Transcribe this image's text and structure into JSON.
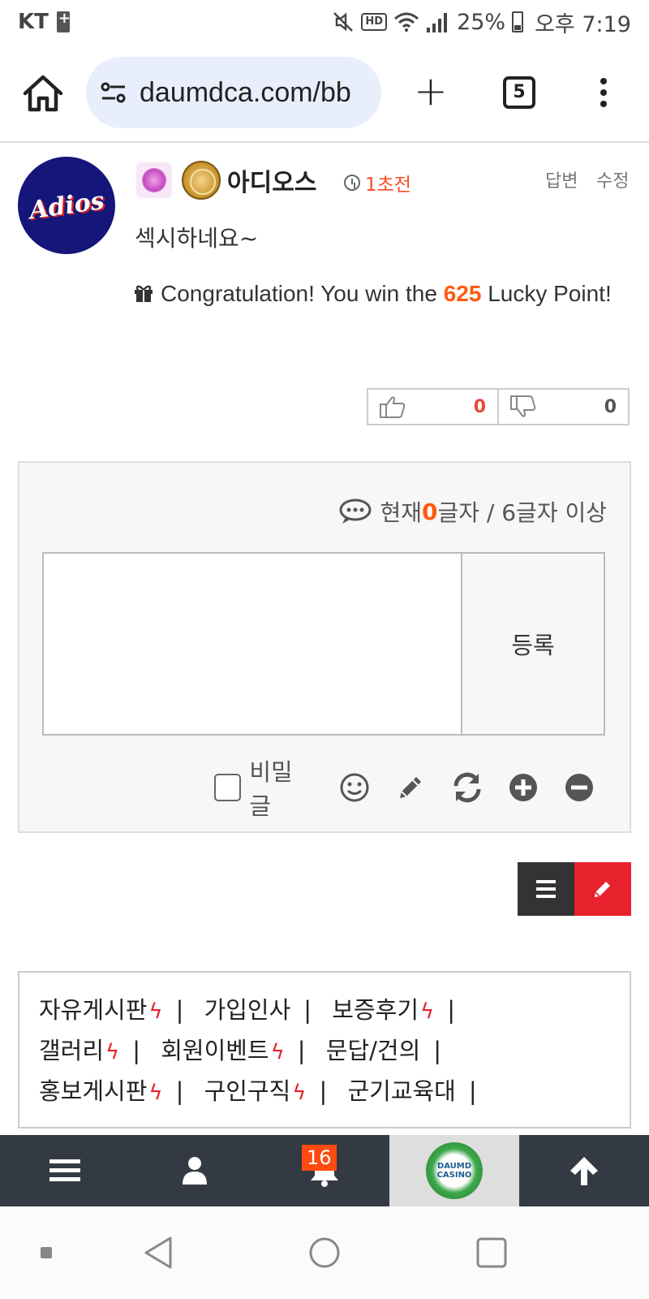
{
  "status_bar": {
    "carrier": "KT",
    "battery": "25%",
    "time": "오후 7:19",
    "icons": [
      "mute-icon",
      "hd-voice-icon",
      "wifi-icon",
      "signal-icon",
      "battery-icon"
    ]
  },
  "browser": {
    "url": "daumdca.com/bb",
    "tab_count": "5",
    "icons": [
      "home-icon",
      "site-settings-icon",
      "new-tab-icon",
      "tabs-icon",
      "more-icon"
    ]
  },
  "comment": {
    "author": "아디오스",
    "avatar_text": "Adios",
    "time": "1초전",
    "reply_label": "답변",
    "edit_label": "수정",
    "text": "섹시하네요~",
    "lucky_prefix": "Congratulation! You win the ",
    "lucky_points": "625",
    "lucky_suffix": " Lucky Point!",
    "likes": "0",
    "dislikes": "0"
  },
  "comment_form": {
    "counter_prefix": "현재 ",
    "counter_value": "0",
    "counter_suffix": "글자 / 6글자 이상",
    "submit_label": "등록",
    "secret_label": "비밀글"
  },
  "board_links": {
    "rows": [
      [
        {
          "label": "자유게시판",
          "hot": true
        },
        {
          "label": "가입인사",
          "hot": false
        },
        {
          "label": "보증후기",
          "hot": true
        }
      ],
      [
        {
          "label": "갤러리",
          "hot": true
        },
        {
          "label": "회원이벤트",
          "hot": true
        },
        {
          "label": "문답/건의",
          "hot": false
        }
      ],
      [
        {
          "label": "홍보게시판",
          "hot": true
        },
        {
          "label": "구인구직",
          "hot": true
        },
        {
          "label": "군기교육대",
          "hot": false
        }
      ]
    ]
  },
  "bottom_nav": {
    "notification_count": "16",
    "logo_line1": "DAUMD",
    "logo_line2": "CASINO"
  },
  "colors": {
    "accent_orange": "#ff5a10",
    "write_red": "#e8222c",
    "nav_dark": "#333a43",
    "url_pill": "#e8eefb"
  }
}
